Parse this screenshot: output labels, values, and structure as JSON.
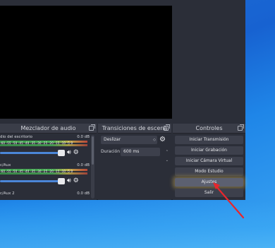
{
  "mixer": {
    "title": "Mezclador de audio",
    "channels": [
      {
        "name": "dio del escritorio",
        "db": "0.0 dB",
        "scale": "-60 -55 -50 -45 -40 -35 -30 -25 -20 -15 -10 -5 0"
      },
      {
        "name": "c/Aux",
        "db": "0.0 dB",
        "scale": "-60 -55 -50 -45 -40 -35 -30 -25 -20 -15 -10 -5 0"
      },
      {
        "name": "c/Aux 2",
        "db": "0.0 dB"
      }
    ],
    "speaker_icon": "speaker-icon",
    "gear_icon": "gear-icon"
  },
  "transitions": {
    "title": "Transiciones de escena",
    "selected": "Deslizar",
    "duration_label": "Duración",
    "duration_value": "600 ms"
  },
  "controls": {
    "title": "Controles",
    "buttons": [
      "Iniciar Transmisión",
      "Iniciar Grabación",
      "Iniciar Cámara Virtual",
      "Modo Estudio",
      "Ajustes",
      "Salir"
    ]
  },
  "colors": {
    "panel_bg": "#2b2e38",
    "button_bg": "#3d404c",
    "slider": "#4b86d8",
    "arrow": "#e8262c",
    "desktop": "#1762d1"
  }
}
